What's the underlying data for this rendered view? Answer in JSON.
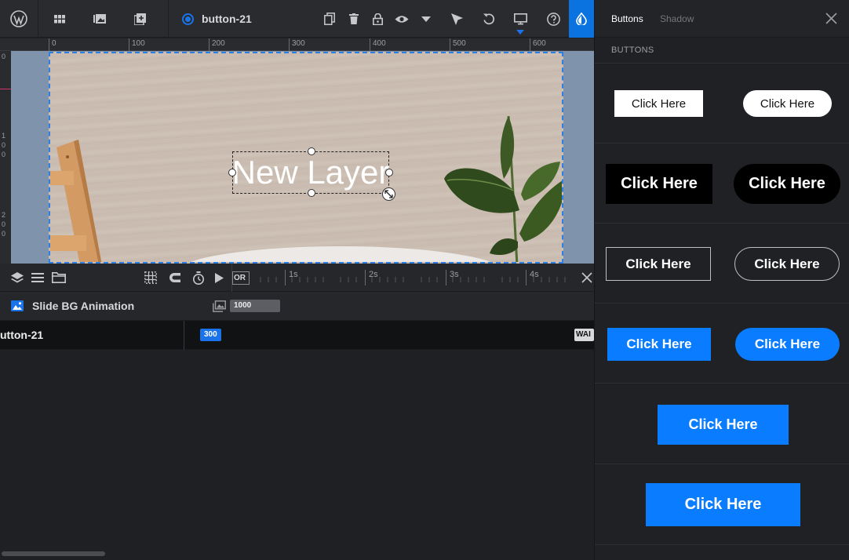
{
  "toolbar": {
    "layer_name": "button-21",
    "icons": [
      "wordpress-icon",
      "grid-icon",
      "library-icon",
      "add-media-icon",
      "duplicate-icon",
      "trash-icon",
      "lock-icon",
      "eye-icon",
      "caret-down-icon",
      "pointer-icon",
      "undo-icon",
      "monitor-icon",
      "help-icon",
      "style-drop-icon"
    ]
  },
  "ruler": {
    "ticks": [
      "0",
      "100",
      "200",
      "300",
      "400",
      "500",
      "600"
    ],
    "vertical": [
      "0",
      "1",
      "0",
      "0",
      "2",
      "0",
      "0"
    ]
  },
  "canvas": {
    "layer_text": "New Layer"
  },
  "timeline": {
    "scale_start": "OR",
    "ticks": [
      "1s",
      "2s",
      "3s",
      "4s"
    ],
    "rows": {
      "bg_animation": {
        "label": "Slide BG Animation",
        "value": "1000"
      },
      "layer": {
        "label": "utton-21",
        "value": "300",
        "end_badge": "WAI"
      }
    }
  },
  "panel": {
    "tabs": [
      "Buttons",
      "Shadow"
    ],
    "section_title": "BUTTONS",
    "button_label": "Click Here",
    "colors": {
      "accent": "#0a7cff",
      "black": "#000000",
      "white": "#ffffff"
    }
  }
}
